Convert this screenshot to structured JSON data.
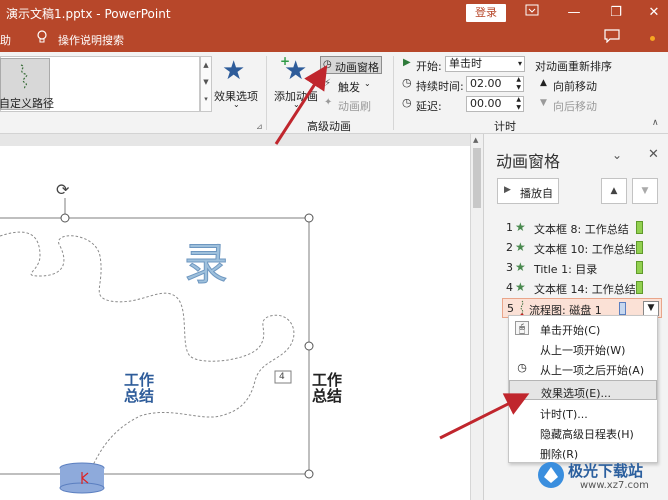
{
  "window": {
    "title": "演示文稿1.pptx  -  PowerPoint",
    "login_label": "登录",
    "min_glyph": "—",
    "max_glyph": "❐",
    "close_glyph": "✕"
  },
  "menubar": {
    "help": "助",
    "tell_me": "操作说明搜索"
  },
  "ribbon": {
    "custom_path": "自定义路径",
    "effect_options": "效果选项",
    "add_animation": "添加动画",
    "animation_pane": "动画窗格",
    "trigger": "触发",
    "animation_painter": "动画刷",
    "group_advanced": "高级动画",
    "start_label": "开始:",
    "start_value": "单击时",
    "duration_label": "持续时间:",
    "duration_value": "02.00",
    "delay_label": "延迟:",
    "delay_value": "00.00",
    "group_timing": "计时",
    "reorder_title": "对动画重新排序",
    "move_earlier": "向前移动",
    "move_later": "向后移动"
  },
  "slide": {
    "title_char": "录",
    "left_text": "工作\n总结",
    "right_text": "工作\n总结",
    "order_tag": "4"
  },
  "pane": {
    "title": "动画窗格",
    "play_label": "播放自",
    "items": [
      {
        "num": "1",
        "label": "文本框 8: 工作总结"
      },
      {
        "num": "2",
        "label": "文本框 10: 工作总结"
      },
      {
        "num": "3",
        "label": "Title 1: 目录"
      },
      {
        "num": "4",
        "label": "文本框 14: 工作总结"
      },
      {
        "num": "5",
        "label": "流程图: 磁盘 1"
      }
    ]
  },
  "context_menu": {
    "items": [
      {
        "label": "单击开始(C)"
      },
      {
        "label": "从上一项开始(W)"
      },
      {
        "label": "从上一项之后开始(A)"
      },
      {
        "label": "效果选项(E)..."
      },
      {
        "label": "计时(T)..."
      },
      {
        "label": "隐藏高级日程表(H)"
      },
      {
        "label": "删除(R)"
      }
    ]
  },
  "watermark": {
    "name": "极光下载站",
    "url": "www.xz7.com"
  },
  "colors": {
    "titlebar": "#b7472a",
    "accent_arrow": "#c0262d",
    "timeline_bar": "#92d050"
  }
}
